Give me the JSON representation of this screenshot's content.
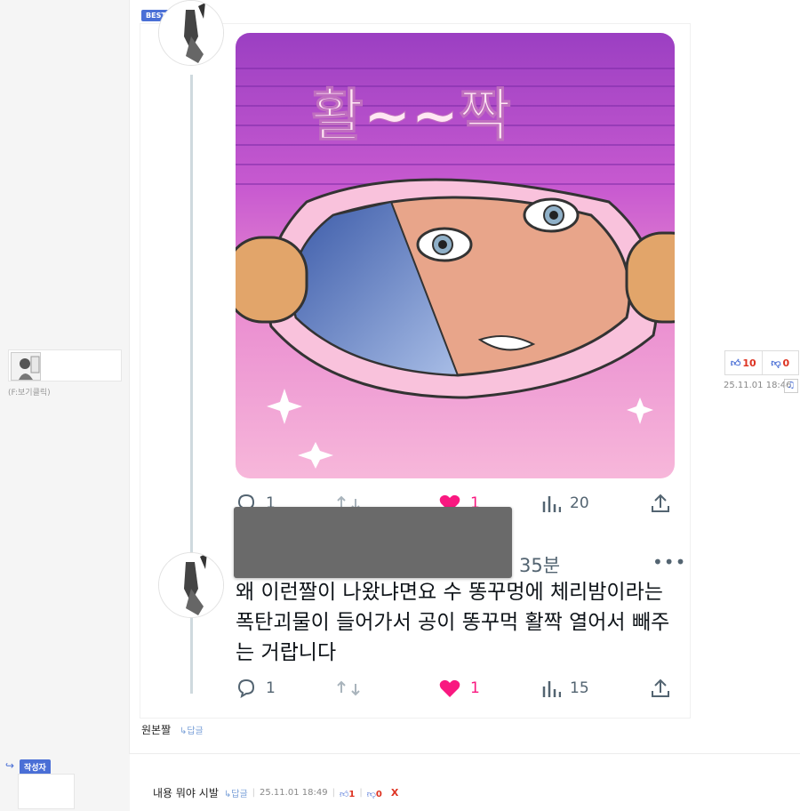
{
  "best_badge": "BEST",
  "user_hint": "(F:보기클릭)",
  "tweet": {
    "image_caption": "활~~짝",
    "top_actions": {
      "replies": "1",
      "likes": "1",
      "views": "20"
    },
    "time_ago": "35분",
    "more": "•••",
    "text": "왜 이런짤이 나왔냐면요 수 똥꾸멍에 체리밤이라는 폭탄괴물이 들어가서 공이 똥꾸먹 활짝 열어서 빼주는 거랍니다",
    "bottom_actions": {
      "replies": "1",
      "likes": "1",
      "views": "15"
    }
  },
  "comment1": {
    "upvotes": "10",
    "downvotes": "0",
    "timestamp": "25.11.01 18:46",
    "text": "원본짤",
    "reply_label": "↳답글"
  },
  "comment2": {
    "author_badge": "작성자",
    "text": "내용 뭐야 시발",
    "reply_label": "↳답글",
    "timestamp": "25.11.01 18:49",
    "upvotes": "1",
    "downvotes": "0",
    "delete_label": "X"
  },
  "colors": {
    "accent": "#4a6fd6",
    "vote": "#dd3322",
    "like_pink": "#f91880"
  }
}
